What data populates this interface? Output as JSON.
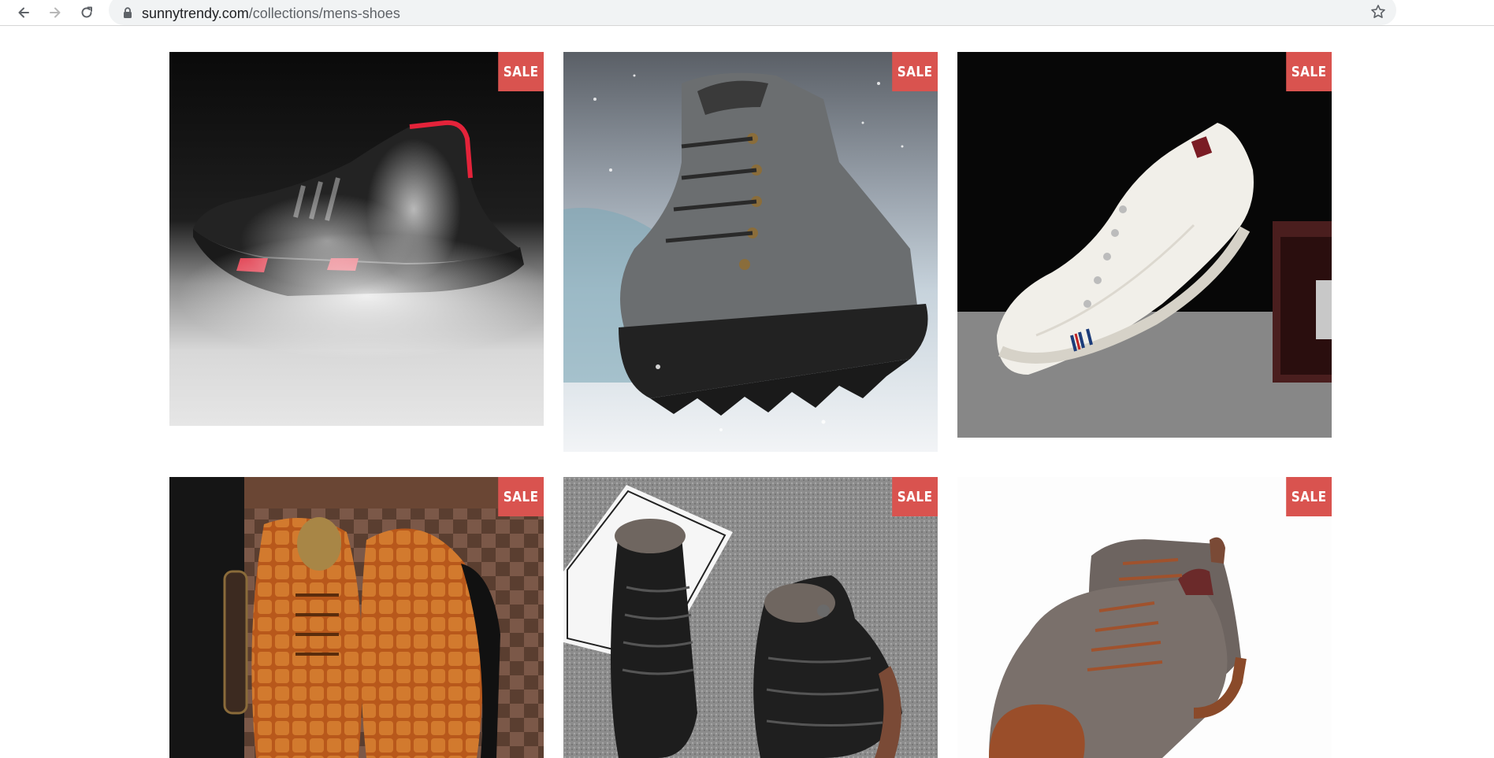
{
  "browser": {
    "url_host": "sunnytrendy.com",
    "url_path": "/collections/mens-shoes",
    "icons": [
      "back-arrow-icon",
      "forward-arrow-icon",
      "reload-icon",
      "lock-icon",
      "bookmark-star-icon"
    ]
  },
  "products": [
    {
      "badge": "SALE",
      "image": "black knit sock sneaker in smoke"
    },
    {
      "badge": "SALE",
      "image": "grey suede hiking boot in snow"
    },
    {
      "badge": "SALE",
      "image": "white canvas low-top sneaker"
    },
    {
      "badge": "SALE",
      "image": "brown croc-embossed oxford shoes"
    },
    {
      "badge": "SALE",
      "image": "black fur-lined snow boots"
    },
    {
      "badge": "SALE",
      "image": "grey and brown lace-up boots"
    }
  ],
  "colors": {
    "sale_badge": "#d9534f",
    "omnibox": "#f1f3f4"
  }
}
